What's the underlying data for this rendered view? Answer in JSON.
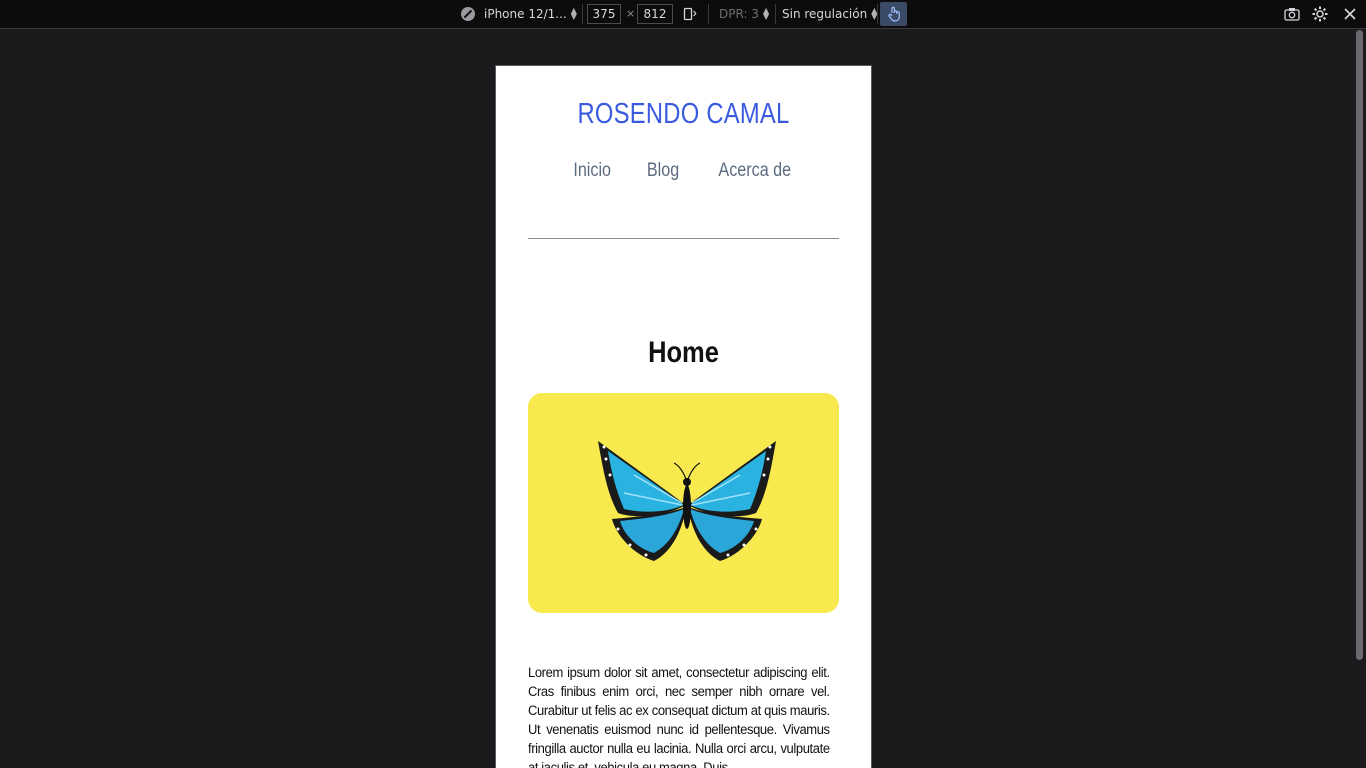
{
  "toolbar": {
    "device_label": "iPhone 12/1...",
    "width_value": "375",
    "height_value": "812",
    "times": "×",
    "dpr_label": "DPR: 3",
    "throttle_label": "Sin regulación",
    "icons": [
      "browser-compass-icon",
      "rotate-icon",
      "touch-icon",
      "screenshot-icon",
      "settings-icon",
      "close-icon"
    ]
  },
  "site": {
    "title": "ROSENDO CAMAL",
    "nav": [
      "Inicio",
      "Blog",
      "Acerca de"
    ],
    "page_title": "Home",
    "hero_bg": "#f7e94e",
    "title_color": "#3a5be0",
    "paragraph": "Lorem ipsum dolor sit amet, consectetur adipiscing elit. Cras finibus enim orci, nec semper nibh ornare vel. Curabitur ut felis ac ex consequat dictum at quis mauris. Ut venenatis euismod nunc id pellentesque. Vivamus fringilla auctor nulla eu lacinia. Nulla orci arcu, vulputate at iaculis et, vehicula eu magna. Duis"
  }
}
